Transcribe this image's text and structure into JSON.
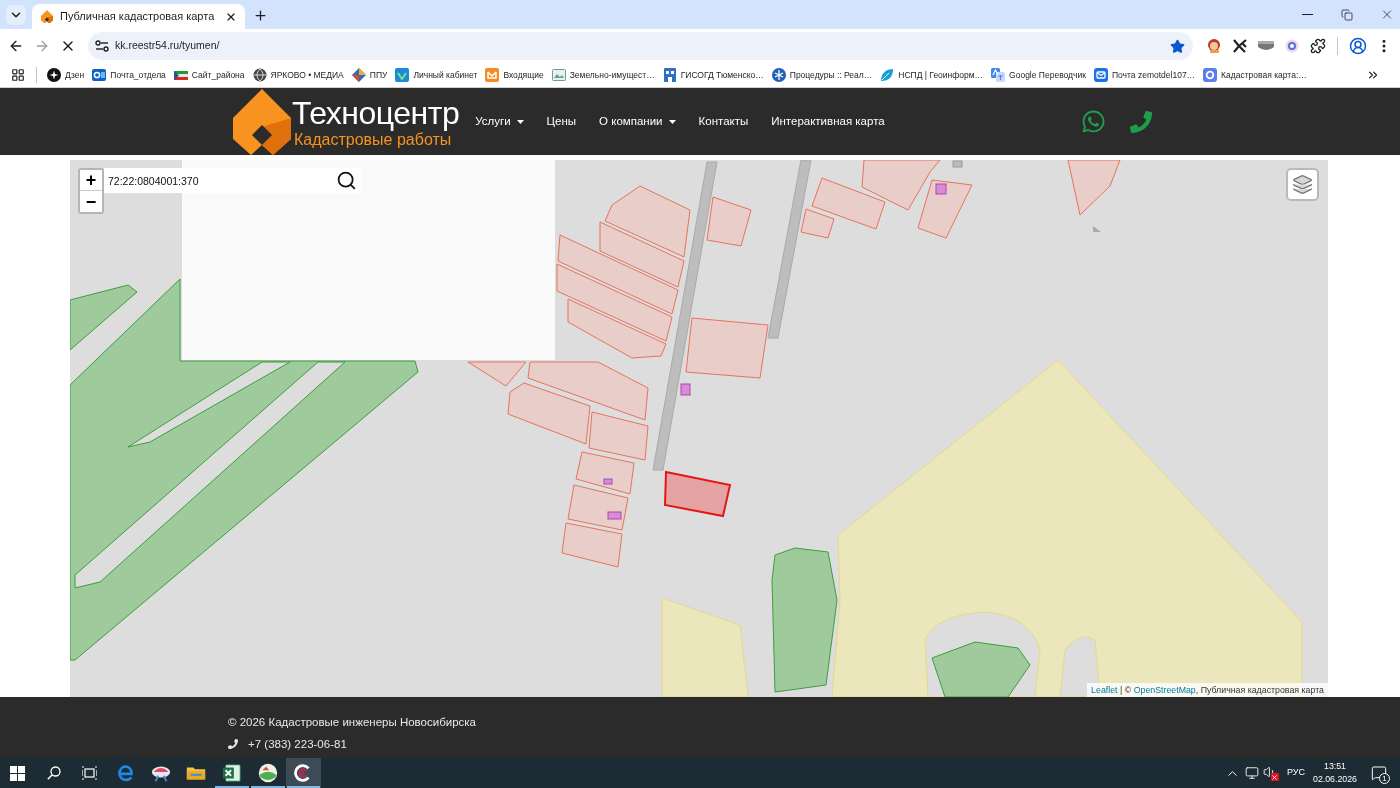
{
  "browser": {
    "tabs": [
      {
        "title": "Публичная кадастровая карта",
        "selected": true
      }
    ],
    "loading": true,
    "address": "kk.reestr54.ru/tyumen/",
    "bookmarked": true,
    "bookmarks": [
      "Дзен",
      "Почта_отдела",
      "Сайт_района",
      "ЯРКОВО • МЕДИА",
      "ППУ",
      "Личный кабинет",
      "Входящие",
      "Земельно-имущест…",
      "ГИСОГД Тюменско…",
      "Процедуры :: Реал…",
      "НСПД | Геоинформ…",
      "Google Переводчик",
      "Почта zemotdel107…",
      "Кадастровая карта:…"
    ]
  },
  "site_header": {
    "logo": {
      "name": "Техноцентр",
      "tagline": "Кадастровые работы"
    },
    "nav": [
      {
        "label": "Услуги",
        "dropdown": true
      },
      {
        "label": "Цены",
        "dropdown": false
      },
      {
        "label": "О компании",
        "dropdown": true
      },
      {
        "label": "Контакты",
        "dropdown": false
      },
      {
        "label": "Интерактивная карта",
        "dropdown": false
      }
    ]
  },
  "map": {
    "zoom_in": "+",
    "zoom_out": "−",
    "search": {
      "value": "72:22:0804001:370"
    },
    "attribution": [
      {
        "kind": "link",
        "text": "Leaflet"
      },
      {
        "kind": "text",
        "text": " | © "
      },
      {
        "kind": "link",
        "text": "OpenStreetMap"
      },
      {
        "kind": "text",
        "text": ", Публичная кадастровая карта"
      }
    ]
  },
  "footer": {
    "copyright": "© 2026 Кадастровые инженеры Новосибирска",
    "phone": "+7 (383) 223-06-81"
  },
  "taskbar": {
    "apps": [
      {
        "running": false,
        "selected": false
      },
      {
        "running": false,
        "selected": false
      },
      {
        "running": false,
        "selected": false
      },
      {
        "running": true,
        "selected": false
      },
      {
        "running": true,
        "selected": false
      },
      {
        "running": true,
        "selected": true
      }
    ],
    "volume_muted": true,
    "language": "РУС",
    "time": "13:51",
    "date": "02.06.2026",
    "notifications": "1"
  }
}
